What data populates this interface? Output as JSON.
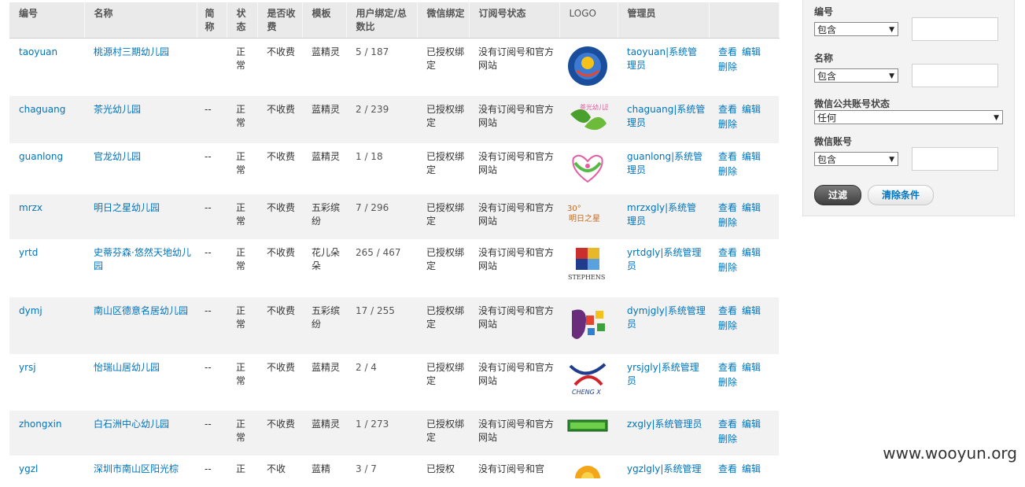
{
  "table": {
    "headers": [
      "编号",
      "名称",
      "简称",
      "状态",
      "是否收费",
      "模板",
      "用户绑定/总数比",
      "微信绑定",
      "订阅号状态",
      "LOGO",
      "管理员",
      ""
    ],
    "rows": [
      {
        "id": "taoyuan",
        "name": "桃源村三期幼儿园",
        "short": "",
        "status": "正常",
        "fee": "不收费",
        "template": "蓝精灵",
        "ratio": "5 / 187",
        "wx": "已授权绑定",
        "sub": "没有订阅号和官方网站",
        "logo": "logo-round-blue",
        "admin": "taoyuan|系统管理员",
        "view": "查看",
        "edit": "编辑",
        "del": "删除"
      },
      {
        "id": "chaguang",
        "name": "茶光幼儿园",
        "short": "--",
        "status": "正常",
        "fee": "不收费",
        "template": "蓝精灵",
        "ratio": "2 / 239",
        "wx": "已授权绑定",
        "sub": "没有订阅号和官方网站",
        "logo": "logo-leaf-green",
        "admin": "chaguang|系统管理员",
        "view": "查看",
        "edit": "编辑",
        "del": "删除",
        "logo_text": "茶光幼儿园"
      },
      {
        "id": "guanlong",
        "name": "官龙幼儿园",
        "short": "--",
        "status": "正常",
        "fee": "不收费",
        "template": "蓝精灵",
        "ratio": "1 / 18",
        "wx": "已授权绑定",
        "sub": "没有订阅号和官方网站",
        "logo": "logo-heart-pink",
        "admin": "guanlong|系统管理员",
        "view": "查看",
        "edit": "编辑",
        "del": "删除"
      },
      {
        "id": "mrzx",
        "name": "明日之星幼儿园",
        "short": "--",
        "status": "正常",
        "fee": "不收费",
        "template": "五彩缤纷",
        "ratio": "7 / 296",
        "wx": "已授权绑定",
        "sub": "没有订阅号和官方网站",
        "logo": "logo-text-orange",
        "admin": "mrzxgly|系统管理员",
        "view": "查看",
        "edit": "编辑",
        "del": "删除",
        "logo_text": "明日之星"
      },
      {
        "id": "yrtd",
        "name": "史蒂芬森·悠然天地幼儿园",
        "short": "--",
        "status": "正常",
        "fee": "不收费",
        "template": "花儿朵朵",
        "ratio": "265 / 467",
        "wx": "已授权绑定",
        "sub": "没有订阅号和官方网站",
        "logo": "logo-shield",
        "admin": "yrtdgly|系统管理员",
        "view": "查看",
        "edit": "编辑",
        "del": "删除",
        "logo_text": "STEPHENS"
      },
      {
        "id": "dymj",
        "name": "南山区德意名居幼儿园",
        "short": "--",
        "status": "正常",
        "fee": "不收费",
        "template": "五彩缤纷",
        "ratio": "17 / 255",
        "wx": "已授权绑定",
        "sub": "没有订阅号和官方网站",
        "logo": "logo-colorful",
        "admin": "dymjgly|系统管理员",
        "view": "查看",
        "edit": "编辑",
        "del": "删除"
      },
      {
        "id": "yrsj",
        "name": "怡瑞山居幼儿园",
        "short": "--",
        "status": "正常",
        "fee": "不收费",
        "template": "蓝精灵",
        "ratio": "2 / 4",
        "wx": "已授权绑定",
        "sub": "没有订阅号和官方网站",
        "logo": "logo-swoosh",
        "admin": "yrsjgly|系统管理员",
        "view": "查看",
        "edit": "编辑",
        "del": "删除",
        "logo_text": "CHENG X"
      },
      {
        "id": "zhongxin",
        "name": "白石洲中心幼儿园",
        "short": "--",
        "status": "正常",
        "fee": "不收费",
        "template": "蓝精灵",
        "ratio": "1 / 273",
        "wx": "已授权绑定",
        "sub": "没有订阅号和官方网站",
        "logo": "logo-banner-green",
        "admin": "zxgly|系统管理员",
        "view": "查看",
        "edit": "编辑",
        "del": "删除"
      },
      {
        "id": "ygzl",
        "name": "深圳市南山区阳光棕",
        "short": "--",
        "status": "正",
        "fee": "不收",
        "template": "蓝精",
        "ratio": "3 / 7",
        "wx": "已授权",
        "sub": "没有订阅号和官",
        "logo": "logo-sun",
        "admin": "ygzlgly|系统管理",
        "view": "查看",
        "edit": "编辑",
        "del": ""
      }
    ]
  },
  "filter": {
    "field1_label": "编号",
    "field1_op": "包含",
    "field2_label": "名称",
    "field2_op": "包含",
    "field3_label": "微信公共账号状态",
    "field3_op": "任何",
    "field4_label": "微信账号",
    "field4_op": "包含",
    "filter_btn": "过滤",
    "clear_btn": "清除条件"
  },
  "watermark": "www.wooyun.org",
  "colors": {
    "link": "#0074bd",
    "header_bg": "#eaeaea",
    "row_alt": "#f2f2f2",
    "panel_bg": "#f3f3f3"
  }
}
